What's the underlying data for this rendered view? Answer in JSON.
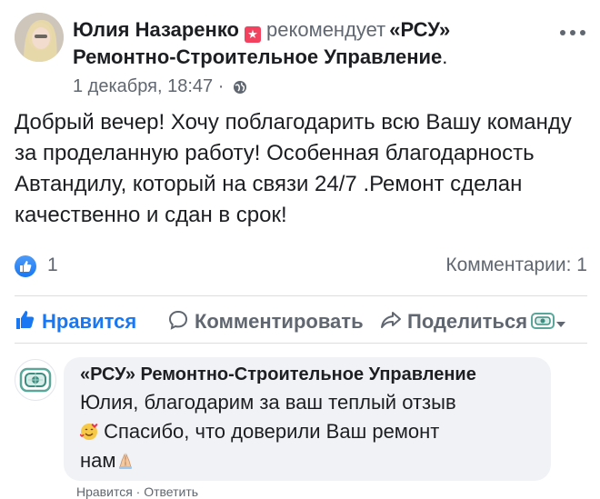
{
  "post": {
    "author": "Юлия Назаренко",
    "recommends_text": "рекомендует",
    "page_name_line1": "«РСУ»",
    "page_name_line2": "Ремонтно-Строительное Управление",
    "page_name_end": ".",
    "date": "1 декабря, 18:47",
    "meta_separator": "·",
    "text": "Добрый вечер! Хочу поблагодарить всю Вашу команду за проделанную работу! Особенная благодарность Автандилу, который на связи 24/7 .Ремонт сделан качественно и сдан в срок!",
    "icons": {
      "recommend_badge": "recommend-star-badge",
      "privacy": "globe-icon",
      "more": "more-horizontal-icon"
    }
  },
  "stats": {
    "likes": "1",
    "comments": "Комментарии: 1",
    "colors": {
      "like_blue": "#1877f2"
    }
  },
  "actions": {
    "like_label": "Нравится",
    "comment_label": "Комментировать",
    "share_label": "Поделиться"
  },
  "comment": {
    "author": "«РСУ» Ремонтно-Строительное Управление",
    "line1": "Юлия, благодарим за ваш теплый отзыв",
    "line2": "Спасибо, что доверили Ваш ремонт",
    "line3": "нам",
    "footer": "Нравится · Ответить"
  }
}
